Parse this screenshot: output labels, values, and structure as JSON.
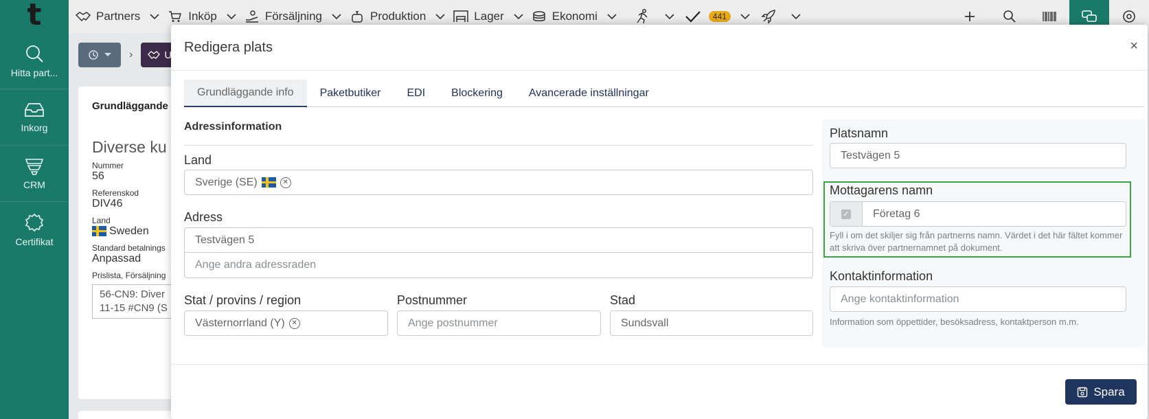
{
  "topnav": {
    "logo": "t",
    "items": [
      {
        "label": "Partners",
        "icon": "handshake-icon"
      },
      {
        "label": "Inköp",
        "icon": "cart-icon"
      },
      {
        "label": "Försäljning",
        "icon": "hand-coin-icon"
      },
      {
        "label": "Produktion",
        "icon": "pot-icon"
      },
      {
        "label": "Lager",
        "icon": "warehouse-icon"
      },
      {
        "label": "Ekonomi",
        "icon": "coins-icon"
      }
    ],
    "runner_icon": "runner-icon",
    "tasks_badge": "441",
    "right_icons": [
      "plus-icon",
      "search-icon",
      "barcode-icon",
      "chat-icon",
      "settings-icon"
    ]
  },
  "sidebar": {
    "items": [
      {
        "label": "Hitta part...",
        "icon": "search-icon"
      },
      {
        "label": "Inkorg",
        "icon": "inbox-icon"
      },
      {
        "label": "CRM",
        "icon": "funnel-icon"
      },
      {
        "label": "Certifikat",
        "icon": "badge-icon"
      }
    ]
  },
  "background": {
    "crumb_partial": "U",
    "card_title": "Grundläggande",
    "name": "Diverse ku",
    "number_label": "Nummer",
    "number_value": "56",
    "ref_label": "Referenskod",
    "ref_value": "DIV46",
    "country_label": "Land",
    "country_value": "Sweden",
    "payment_label": "Standard betalnings",
    "payment_value": "Anpassad",
    "pricelist_label": "Prislista, Försäljning",
    "pricelist_value": "56-CN9: Diver 11-15 #CN9 (S"
  },
  "modal": {
    "title": "Redigera plats",
    "close": "×",
    "tabs": [
      "Grundläggande info",
      "Paketbutiker",
      "EDI",
      "Blockering",
      "Avancerade inställningar"
    ],
    "active_tab": 0,
    "address_section": "Adressinformation",
    "country": {
      "label": "Land",
      "value": "Sverige (SE)"
    },
    "address": {
      "label": "Adress",
      "line1": "Testvägen 5",
      "line2_placeholder": "Ange andra adressraden"
    },
    "state": {
      "label": "Stat / provins / region",
      "value": "Västernorrland (Y)"
    },
    "postal": {
      "label": "Postnummer",
      "placeholder": "Ange postnummer"
    },
    "city": {
      "label": "Stad",
      "value": "Sundsvall"
    },
    "place_name": {
      "label": "Platsnamn",
      "value": "Testvägen 5"
    },
    "recipient": {
      "label": "Mottagarens namn",
      "value": "Företag 6",
      "help": "Fyll i om det skiljer sig från partnerns namn. Värdet i det här fältet kommer att skriva över partnernamnet på dokument."
    },
    "contact": {
      "label": "Kontaktinformation",
      "placeholder": "Ange kontaktinformation",
      "help": "Information som öppettider, besöksadress, kontaktperson m.m."
    },
    "save_label": "Spara"
  },
  "colors": {
    "brand": "#1a7a6a",
    "primary_button": "#1f3560",
    "highlight": "#3da14a",
    "badge": "#e5a91c"
  }
}
